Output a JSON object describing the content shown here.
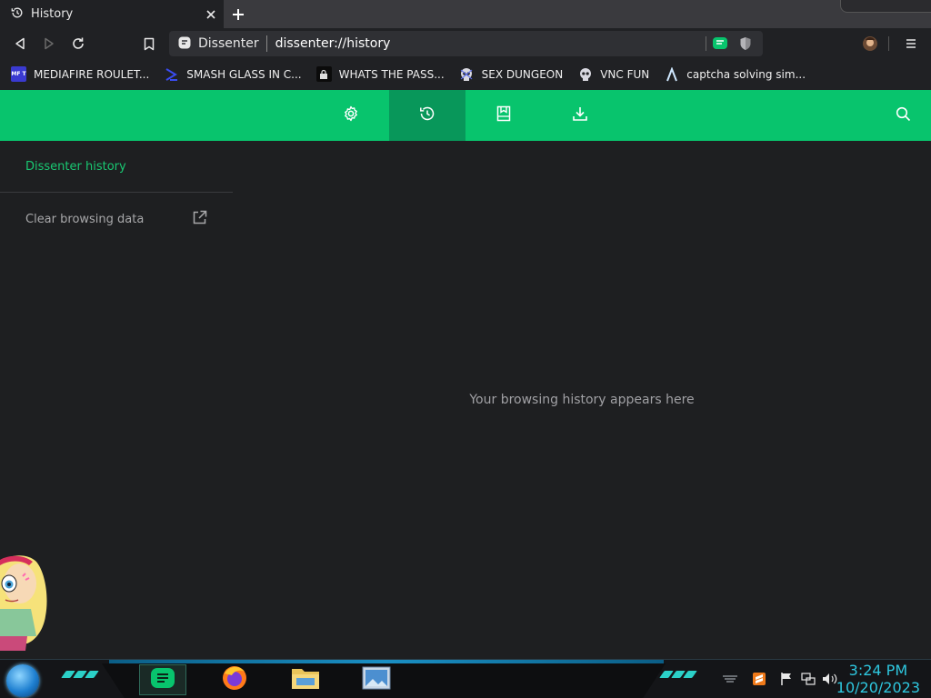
{
  "tab": {
    "title": "History"
  },
  "omnibox": {
    "site_name": "Dissenter",
    "url": "dissenter://history"
  },
  "bookmarks": [
    {
      "label": "MEDIAFIRE ROULET...",
      "icon": "mediafire-icon",
      "icon_text": "MF T"
    },
    {
      "label": "SMASH GLASS IN C...",
      "icon": "chevron-right-icon"
    },
    {
      "label": "WHATS THE PASS...",
      "icon": "lock-icon"
    },
    {
      "label": "SEX DUNGEON",
      "icon": "skull-icon"
    },
    {
      "label": "VNC FUN",
      "icon": "skull-icon"
    },
    {
      "label": "captcha solving sim...",
      "icon": "lambda-icon"
    }
  ],
  "header": {
    "buttons": [
      "settings-icon",
      "history-icon",
      "bookmarks-icon",
      "downloads-icon"
    ],
    "active": "history-icon",
    "search_icon": "search-icon"
  },
  "sidebar": {
    "title": "Dissenter history",
    "clear_label": "Clear browsing data"
  },
  "main": {
    "empty_message": "Your browsing history appears here"
  },
  "taskbar": {
    "apps": [
      "dissenter-app-icon",
      "firefox-icon",
      "file-explorer-icon",
      "image-viewer-icon"
    ],
    "time": "3:24 PM",
    "date": "10/20/2023"
  },
  "colors": {
    "accent": "#08c46d",
    "accent_active": "#08975a",
    "background": "#1e1f21",
    "sidebar_title": "#19c872",
    "clock": "#2ec8e0"
  }
}
